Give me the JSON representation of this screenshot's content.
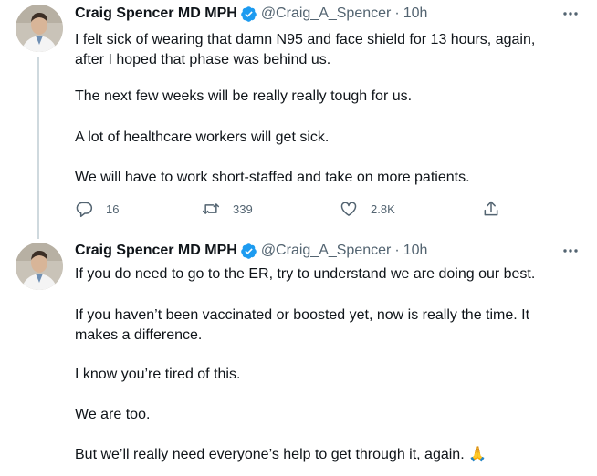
{
  "tweets": [
    {
      "author_name": "Craig Spencer MD MPH",
      "handle": "@Craig_A_Spencer",
      "separator": "·",
      "time": "10h",
      "paragraphs": [
        "I felt sick of wearing that damn N95 and face shield for 13 hours, again,",
        "after I hoped that phase was behind us.",
        "The next few weeks will be really really tough for us.",
        "A lot of healthcare workers will get sick.",
        "We will have to work short-staffed and take on more patients."
      ],
      "actions": {
        "replies": "16",
        "retweets": "339",
        "likes": "2.8K"
      }
    },
    {
      "author_name": "Craig Spencer MD MPH",
      "handle": "@Craig_A_Spencer",
      "separator": "·",
      "time": "10h",
      "paragraphs": [
        "If you do need to go to the ER, try to understand we are doing our best.",
        "If you haven’t been vaccinated or boosted yet, now is really the time. It",
        "makes a difference.",
        "I know you’re tired of this.",
        "We are too.",
        "But we’ll really need everyone’s help to get through it, again. 🙏"
      ]
    }
  ],
  "colors": {
    "text": "#0f1419",
    "secondary": "#536471",
    "verified": "#1d9bf0",
    "thread_line": "#cfd9de"
  },
  "icons": [
    "more-icon",
    "verified-badge-icon",
    "reply-icon",
    "retweet-icon",
    "like-icon",
    "share-icon"
  ]
}
